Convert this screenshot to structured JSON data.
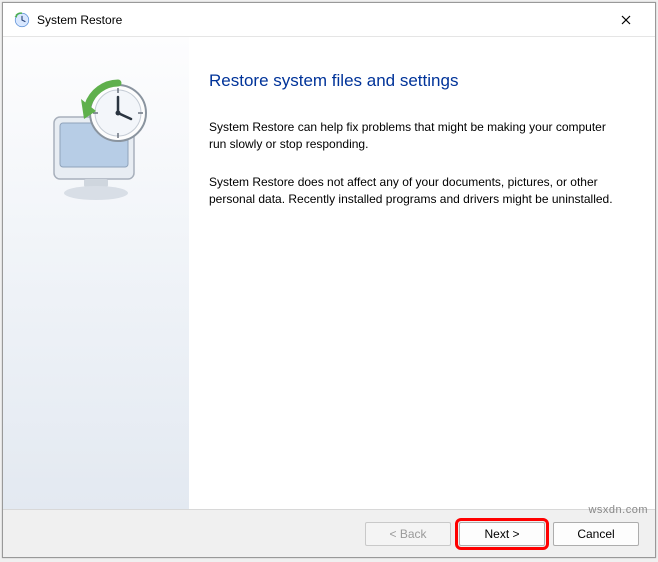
{
  "window": {
    "title": "System Restore"
  },
  "main": {
    "heading": "Restore system files and settings",
    "paragraph1": "System Restore can help fix problems that might be making your computer run slowly or stop responding.",
    "paragraph2": "System Restore does not affect any of your documents, pictures, or other personal data. Recently installed programs and drivers might be uninstalled."
  },
  "footer": {
    "back_label": "< Back",
    "next_label": "Next >",
    "cancel_label": "Cancel"
  },
  "watermark": "wsxdn.com"
}
